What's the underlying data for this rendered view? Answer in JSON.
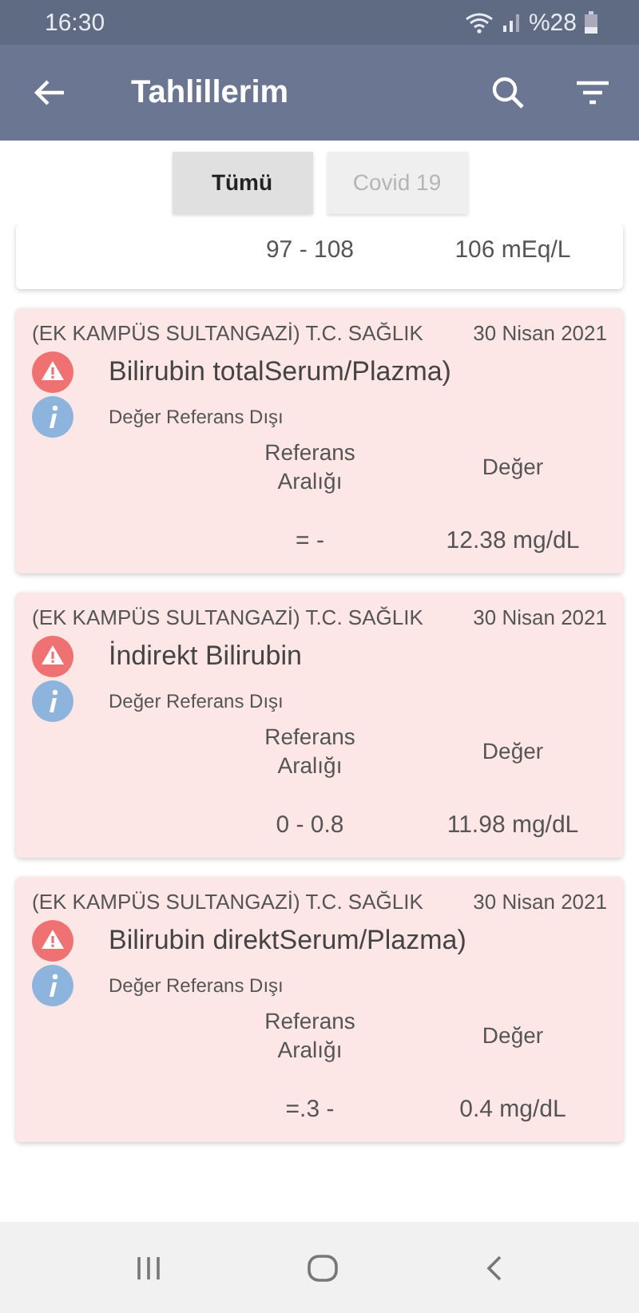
{
  "status_bar": {
    "time": "16:30",
    "battery": "%28"
  },
  "app_bar": {
    "title": "Tahlillerim"
  },
  "tabs": [
    {
      "label": "Tümü",
      "selected": true
    },
    {
      "label": "Covid 19",
      "selected": false
    }
  ],
  "results": [
    {
      "out_of_range": false,
      "reference": "97 - 108",
      "value": "106 mEq/L"
    },
    {
      "out_of_range": true,
      "institution": "(EK KAMPÜS SULTANGAZİ) T.C. SAĞLIK",
      "date": "30 Nisan 2021",
      "test": "Bilirubin totalSerum/Plazma)",
      "note": "Değer Referans Dışı",
      "reference_header": "Referans Aralığı",
      "value_header": "Değer",
      "reference": "= -",
      "value": "12.38 mg/dL"
    },
    {
      "out_of_range": true,
      "institution": "(EK KAMPÜS SULTANGAZİ) T.C. SAĞLIK",
      "date": "30 Nisan 2021",
      "test": "İndirekt Bilirubin",
      "note": "Değer Referans Dışı",
      "reference_header": "Referans Aralığı",
      "value_header": "Değer",
      "reference": "0 - 0.8",
      "value": "11.98 mg/dL"
    },
    {
      "out_of_range": true,
      "institution": "(EK KAMPÜS SULTANGAZİ) T.C. SAĞLIK",
      "date": "30 Nisan 2021",
      "test": "Bilirubin direktSerum/Plazma)",
      "note": "Değer Referans Dışı",
      "reference_header": "Referans Aralığı",
      "value_header": "Değer",
      "reference": "=.3 -",
      "value": "0.4 mg/dL"
    }
  ]
}
